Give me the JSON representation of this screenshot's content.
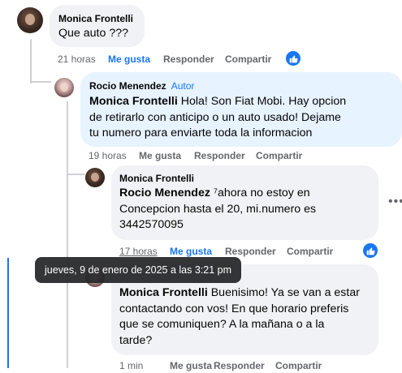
{
  "comments": [
    {
      "author": "Monica Frontelli",
      "text": "Que auto ???",
      "time": "21 horas",
      "like_label": "Me gusta",
      "reply_label": "Responder",
      "share_label": "Compartir"
    },
    {
      "author": "Rocio Menendez",
      "author_badge": "Autor",
      "mention": "Monica Frontelli",
      "text_lines": [
        " Hola! Son Fiat Mobi. Hay opcion",
        "de retirarlo con anticipo o un auto usado! Dejame",
        "tu numero para enviarte toda la informacion"
      ],
      "time": "19 horas",
      "like_label": "Me gusta",
      "reply_label": "Responder",
      "share_label": "Compartir"
    },
    {
      "author": "Monica Frontelli",
      "mention": "Rocio Menendez",
      "text_lines": [
        " ⁷ahora no estoy en",
        "Concepcion hasta el 20, mi.numero es",
        "3442570095"
      ],
      "time": "17 horas",
      "like_label": "Me gusta",
      "reply_label": "Responder",
      "share_label": "Compartir"
    },
    {
      "mention": "Monica Frontelli",
      "text_lines": [
        " Buenisimo! Ya se van a estar",
        "contactando con vos! En que horario preferis",
        "que se comuniquen? A la mañana o a la",
        "tarde?"
      ],
      "time": "1 min",
      "like_label": "Me gusta",
      "reply_label": "Responder",
      "share_label": "Compartir"
    }
  ],
  "tooltip": "jueves, 9 de enero de 2025 a las 3:21 pm",
  "more_options": "•••",
  "colors": {
    "accent": "#1877f2",
    "bubble": "#f0f2f5",
    "bubble_highlight": "#e7f3ff",
    "meta": "#65676b"
  },
  "icons": {
    "like_badge": "thumbs-up-icon",
    "more": "more-options-icon"
  }
}
